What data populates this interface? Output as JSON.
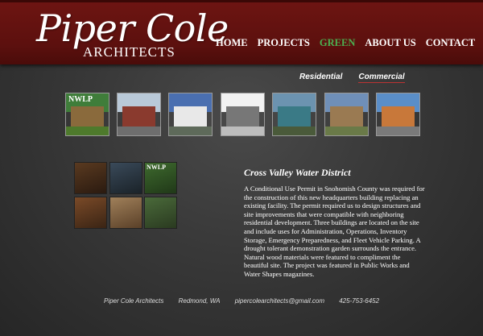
{
  "logo": {
    "name": "Piper Cole",
    "subtitle": "ARCHITECTS"
  },
  "nav": [
    "HOME",
    "PROJECTS",
    "GREEN",
    "ABOUT US",
    "CONTACT"
  ],
  "nav_active": "GREEN",
  "subnav": [
    "Residential",
    "Commercial"
  ],
  "subnav_active": "Commercial",
  "thumbs": [
    {
      "label": "NWLP",
      "sky": "#3f7d3a",
      "bld": "#8a6a3c",
      "gnd": "#4e7a2c"
    },
    {
      "label": "",
      "sky": "#b9c9d8",
      "bld": "#8a3a2e",
      "gnd": "#6e6e6e"
    },
    {
      "label": "",
      "sky": "#4a6fb0",
      "bld": "#e8e8e8",
      "gnd": "#5e6a5a"
    },
    {
      "label": "",
      "sky": "#f2f2f2",
      "bld": "#777777",
      "gnd": "#bdbdbd"
    },
    {
      "label": "",
      "sky": "#6c93b0",
      "bld": "#3a7a86",
      "gnd": "#4a5a3a"
    },
    {
      "label": "",
      "sky": "#6f8fb8",
      "bld": "#9a7a52",
      "gnd": "#6a7a48"
    },
    {
      "label": "",
      "sky": "#5a8ec8",
      "bld": "#c8783a",
      "gnd": "#7a7a7a"
    }
  ],
  "gallery": [
    {
      "label": "",
      "c1": "#5a3a20",
      "c2": "#2a1a10"
    },
    {
      "label": "",
      "c1": "#3a4a5a",
      "c2": "#1a2228"
    },
    {
      "label": "NWLP",
      "c1": "#3e6a2e",
      "c2": "#203818"
    },
    {
      "label": "",
      "c1": "#7a4a28",
      "c2": "#3a2414"
    },
    {
      "label": "",
      "c1": "#a0805a",
      "c2": "#5a4028"
    },
    {
      "label": "",
      "c1": "#4a6a3a",
      "c2": "#2a3a20"
    }
  ],
  "project": {
    "title": "Cross Valley Water District",
    "description": "A Conditional Use Permit in Snohomish County was required for the construction of this new headquarters building replacing an existing facility. The permit required us to design structures and site improvements that were compatible with neighboring residential development. Three buildings are located on the site and include uses for Administration, Operations, Inventory Storage, Emergency Preparedness, and Fleet Vehicle Parking. A drought tolerant demonstration garden surrounds the entrance. Natural wood materials were featured to compliment the beautiful site. The project was featured in Public Works and Water Shapes magazines."
  },
  "footer": {
    "company": "Piper Cole Architects",
    "location": "Redmond, WA",
    "email": "pipercolearchitects@gmail.com",
    "phone": "425-753-6452"
  },
  "colors": {
    "header": "#5c100e",
    "nav_active": "#4caf50",
    "background": "#333333"
  }
}
